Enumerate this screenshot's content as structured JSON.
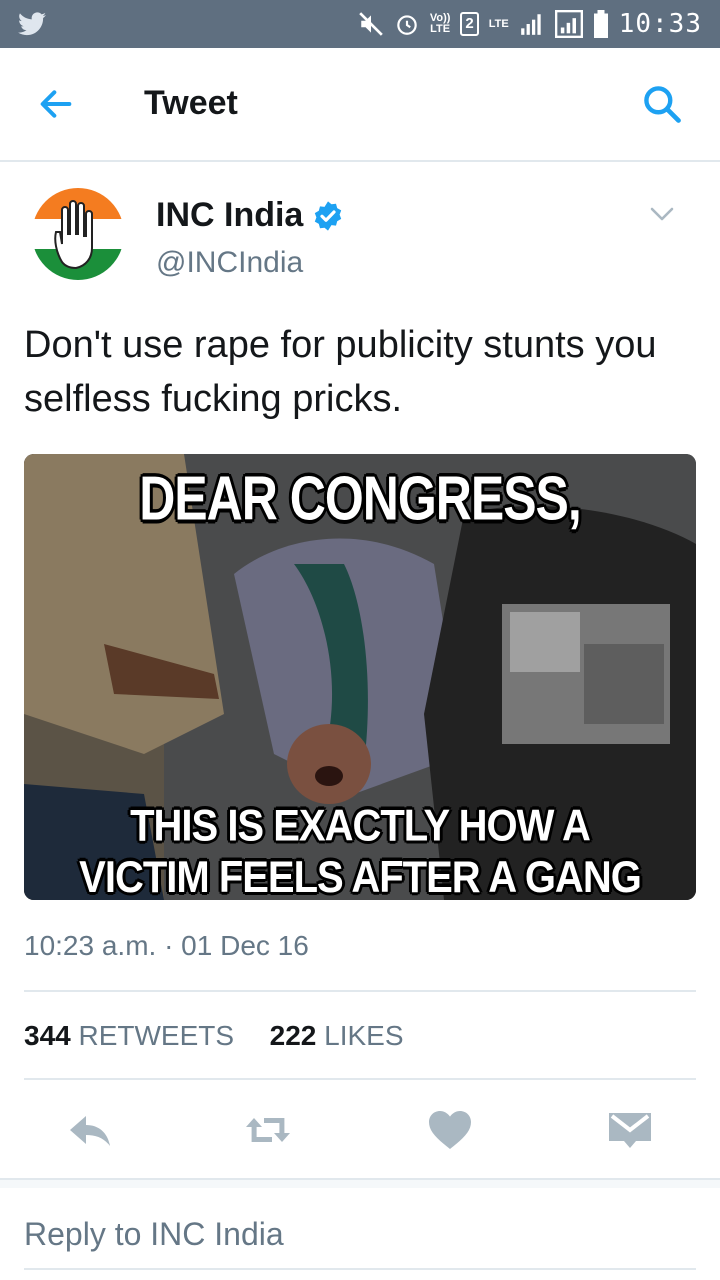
{
  "status_bar": {
    "lte_top": "Vo))",
    "lte_bottom": "LTE",
    "sim_slot": "2",
    "network": "LTE",
    "time": "10:33"
  },
  "app_bar": {
    "title": "Tweet",
    "back_icon": "arrow-left-icon",
    "search_icon": "search-icon"
  },
  "tweet": {
    "author_name": "INC India",
    "handle": "@INCIndia",
    "verified": true,
    "text": "Don't use rape for publicity stunts you selfless fucking pricks.",
    "media": {
      "caption_top": "DEAR CONGRESS,",
      "caption_bottom_line1": "THIS IS EXACTLY HOW A",
      "caption_bottom_line2": "VICTIM FEELS AFTER A GANG RAPE"
    },
    "timestamp": "10:23 a.m. · 01 Dec 16",
    "retweets_count": "344",
    "retweets_label": "RETWEETS",
    "likes_count": "222",
    "likes_label": "LIKES"
  },
  "actions": [
    "reply-icon",
    "retweet-icon",
    "like-icon",
    "direct-message-icon"
  ],
  "reply": {
    "placeholder": "Reply to INC India"
  },
  "colors": {
    "status_bar": "#5f6f80",
    "twitter_blue": "#1da1f2",
    "icon_gray": "#aab8c2",
    "secondary_text": "#657786",
    "primary_text": "#14171a"
  }
}
